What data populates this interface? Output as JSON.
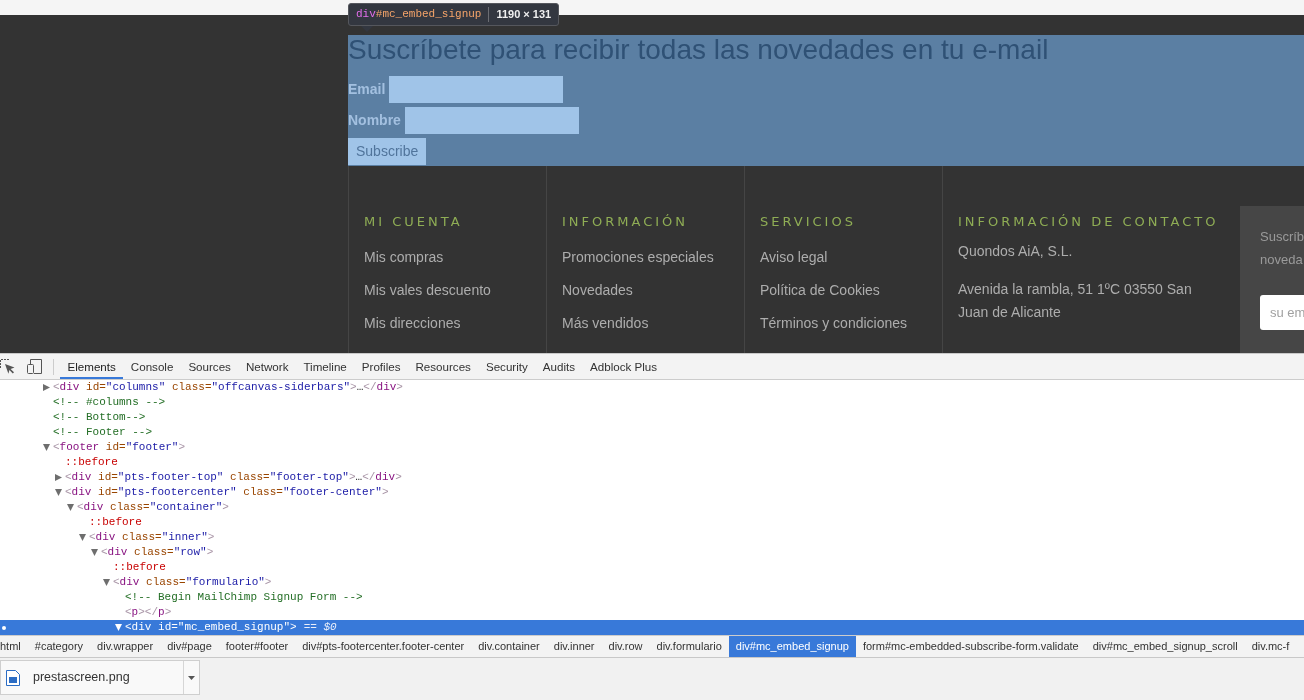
{
  "element_tooltip": {
    "tag": "div",
    "selector": "#mc_embed_signup",
    "size": "1190 × 131"
  },
  "signup_form": {
    "title": "Suscríbete para recibir todas las novedades en tu e-mail",
    "fields": [
      {
        "label": "Email"
      },
      {
        "label": "Nombre"
      }
    ],
    "button": "Subscribe"
  },
  "footer": {
    "columns": [
      {
        "heading": "MI CUENTA",
        "links": [
          "Mis compras",
          "Mis vales descuento",
          "Mis direcciones"
        ]
      },
      {
        "heading": "INFORMACIÓN",
        "links": [
          "Promociones especiales",
          "Novedades",
          "Más vendidos"
        ]
      },
      {
        "heading": "SERVICIOS",
        "links": [
          "Aviso legal",
          "Política de Cookies",
          "Términos y condiciones"
        ]
      }
    ],
    "contact": {
      "heading": "INFORMACIÓN DE CONTACTO",
      "lines": [
        "Quondos AiA, S.L.",
        "Avenida la rambla, 51 1ºC 03550 San Juan de Alicante"
      ]
    },
    "newsletter": {
      "text_lines": [
        "Suscríb",
        "noveda"
      ],
      "placeholder": "su em"
    }
  },
  "devtools": {
    "tabs": [
      {
        "label": "Elements",
        "selected": true
      },
      {
        "label": "Console",
        "selected": false
      },
      {
        "label": "Sources",
        "selected": false
      },
      {
        "label": "Network",
        "selected": false
      },
      {
        "label": "Timeline",
        "selected": false
      },
      {
        "label": "Profiles",
        "selected": false
      },
      {
        "label": "Resources",
        "selected": false
      },
      {
        "label": "Security",
        "selected": false
      },
      {
        "label": "Audits",
        "selected": false
      },
      {
        "label": "Adblock Plus",
        "selected": false
      }
    ],
    "dom_tree": [
      {
        "kind": "element",
        "text": "<div id=\"columns\" class=\"offcanvas-siderbars\">…</div>",
        "expanded": false,
        "selected": false
      },
      {
        "kind": "comment",
        "text": "<!-- #columns -->",
        "selected": false
      },
      {
        "kind": "comment",
        "text": "<!-- Bottom-->",
        "selected": false
      },
      {
        "kind": "comment",
        "text": "<!-- Footer -->",
        "selected": false
      },
      {
        "kind": "element",
        "text": "<footer id=\"footer\">",
        "expanded": true,
        "selected": false,
        "children": [
          {
            "kind": "pseudo",
            "text": "::before",
            "selected": false
          },
          {
            "kind": "element",
            "text": "<div id=\"pts-footer-top\" class=\"footer-top\">…</div>",
            "expanded": false,
            "selected": false
          },
          {
            "kind": "element",
            "text": "<div id=\"pts-footercenter\" class=\"footer-center\">",
            "expanded": true,
            "selected": false,
            "children": [
              {
                "kind": "element",
                "text": "<div class=\"container\">",
                "expanded": true,
                "selected": false,
                "children": [
                  {
                    "kind": "pseudo",
                    "text": "::before",
                    "selected": false
                  },
                  {
                    "kind": "element",
                    "text": "<div class=\"inner\">",
                    "expanded": true,
                    "selected": false,
                    "children": [
                      {
                        "kind": "element",
                        "text": "<div class=\"row\">",
                        "expanded": true,
                        "selected": false,
                        "children": [
                          {
                            "kind": "pseudo",
                            "text": "::before",
                            "selected": false
                          },
                          {
                            "kind": "element",
                            "text": "<div class=\"formulario\">",
                            "expanded": true,
                            "selected": false,
                            "children": [
                              {
                                "kind": "comment",
                                "text": "<!-- Begin MailChimp Signup Form -->",
                                "selected": false
                              },
                              {
                                "kind": "element",
                                "text": "<p></p>",
                                "selected": false
                              },
                              {
                                "kind": "element",
                                "text": "<div id=\"mc_embed_signup\">",
                                "expanded": true,
                                "selected": true,
                                "suffix": "== $0"
                              }
                            ]
                          }
                        ]
                      }
                    ]
                  }
                ]
              }
            ]
          }
        ]
      }
    ],
    "breadcrumbs": [
      {
        "label": "html",
        "selected": false
      },
      {
        "label": "#category",
        "selected": false
      },
      {
        "label": "div.wrapper",
        "selected": false
      },
      {
        "label": "div#page",
        "selected": false
      },
      {
        "label": "footer#footer",
        "selected": false
      },
      {
        "label": "div#pts-footercenter.footer-center",
        "selected": false
      },
      {
        "label": "div.container",
        "selected": false
      },
      {
        "label": "div.inner",
        "selected": false
      },
      {
        "label": "div.row",
        "selected": false
      },
      {
        "label": "div.formulario",
        "selected": false
      },
      {
        "label": "div#mc_embed_signup",
        "selected": true
      },
      {
        "label": "form#mc-embedded-subscribe-form.validate",
        "selected": false
      },
      {
        "label": "div#mc_embed_signup_scroll",
        "selected": false
      },
      {
        "label": "div.mc-f",
        "selected": false
      }
    ]
  },
  "download_shelf": {
    "items": [
      {
        "file_name": "prestascreen.png"
      }
    ]
  }
}
